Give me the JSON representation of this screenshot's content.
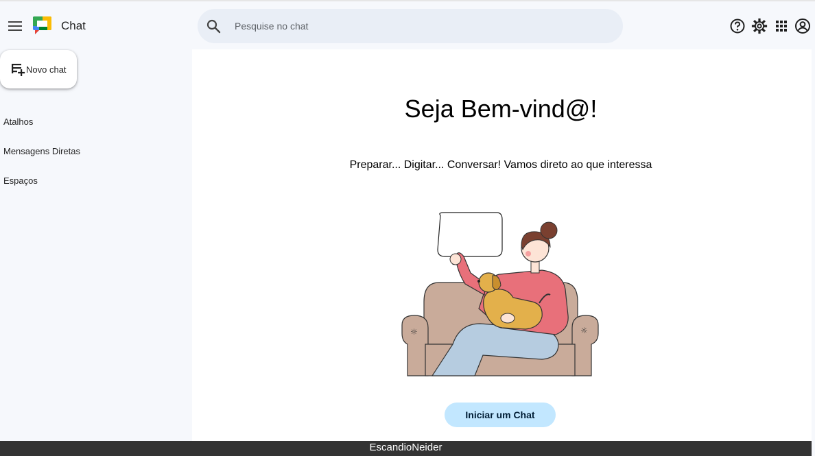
{
  "header": {
    "app_title": "Chat",
    "search_placeholder": "Pesquise no chat"
  },
  "sidebar": {
    "new_chat_label": "Novo chat",
    "items": [
      {
        "label": "Atalhos"
      },
      {
        "label": "Mensagens Diretas"
      },
      {
        "label": "Espaços"
      }
    ]
  },
  "main": {
    "title": "Seja Bem-vind@!",
    "subtitle": "Preparar... Digitar... Conversar! Vamos direto ao que interessa",
    "start_button": "Iniciar um Chat"
  },
  "footer": {
    "text": "EscandioNeider"
  },
  "icons": [
    "menu-icon",
    "chat-logo-icon",
    "search-icon",
    "help-icon",
    "gear-icon",
    "apps-grid-icon",
    "account-icon",
    "new-chat-icon"
  ],
  "colors": {
    "page_bg": "#f6f8fc",
    "search_bg": "#e9eef6",
    "button_bg": "#c2e7ff",
    "footer_bg": "#333333"
  }
}
